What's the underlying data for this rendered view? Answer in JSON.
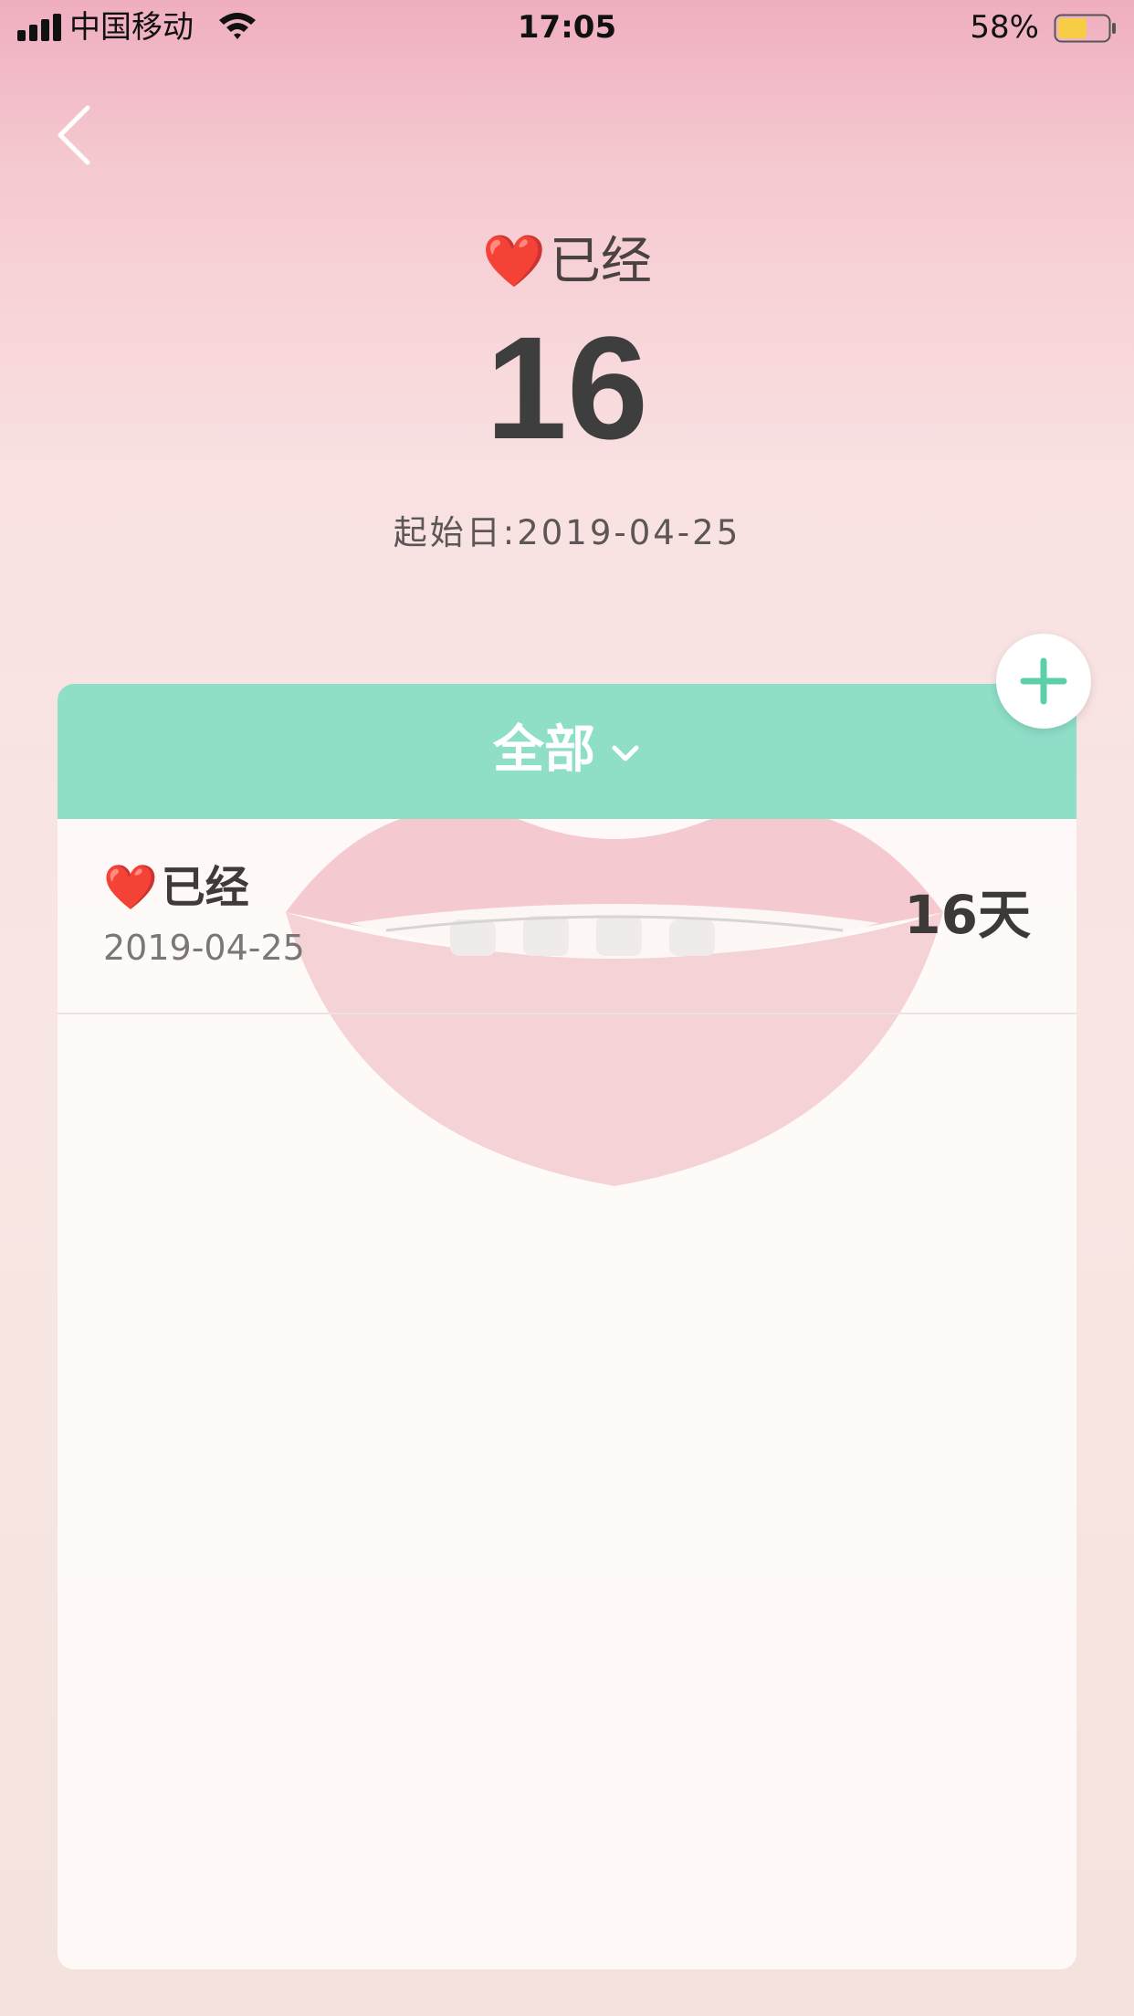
{
  "status_bar": {
    "carrier": "中国移动",
    "time": "17:05",
    "battery_percent": "58%",
    "battery_level": 0.58,
    "battery_color": "#f7cd45"
  },
  "header": {
    "back_icon": "chevron-left-icon",
    "heart": "❤️",
    "title": "已经",
    "count": "16",
    "start_date_label": "起始日:2019-04-25"
  },
  "card": {
    "header_color": "#8edec8",
    "filter_label": "全部",
    "filter_icon": "chevron-down-icon",
    "items": [
      {
        "heart": "❤️",
        "title": "已经",
        "date": "2019-04-25",
        "days": "16天"
      }
    ]
  },
  "add_button": {
    "icon": "plus-icon",
    "color": "#5ccfa9"
  }
}
